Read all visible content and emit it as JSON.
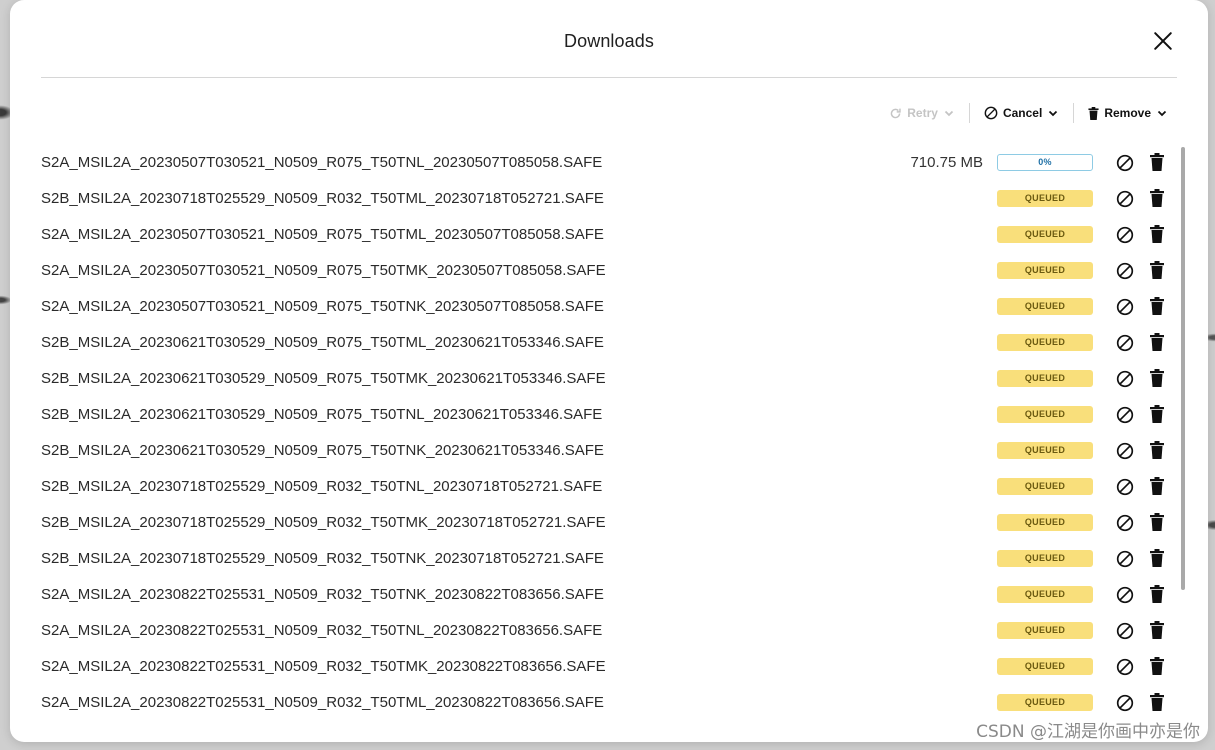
{
  "dialog": {
    "title": "Downloads"
  },
  "toolbar": {
    "retry_label": "Retry",
    "cancel_label": "Cancel",
    "remove_label": "Remove"
  },
  "colors": {
    "queued_badge": "#f9df7b",
    "progress_border": "#8ecbe4"
  },
  "downloads": [
    {
      "name": "S2A_MSIL2A_20230507T030521_N0509_R075_T50TNL_20230507T085058.SAFE",
      "size": "710.75 MB",
      "status": "0%",
      "progress": 0
    },
    {
      "name": "S2B_MSIL2A_20230718T025529_N0509_R032_T50TML_20230718T052721.SAFE",
      "size": "",
      "status": "QUEUED"
    },
    {
      "name": "S2A_MSIL2A_20230507T030521_N0509_R075_T50TML_20230507T085058.SAFE",
      "size": "",
      "status": "QUEUED"
    },
    {
      "name": "S2A_MSIL2A_20230507T030521_N0509_R075_T50TMK_20230507T085058.SAFE",
      "size": "",
      "status": "QUEUED"
    },
    {
      "name": "S2A_MSIL2A_20230507T030521_N0509_R075_T50TNK_20230507T085058.SAFE",
      "size": "",
      "status": "QUEUED"
    },
    {
      "name": "S2B_MSIL2A_20230621T030529_N0509_R075_T50TML_20230621T053346.SAFE",
      "size": "",
      "status": "QUEUED"
    },
    {
      "name": "S2B_MSIL2A_20230621T030529_N0509_R075_T50TMK_20230621T053346.SAFE",
      "size": "",
      "status": "QUEUED"
    },
    {
      "name": "S2B_MSIL2A_20230621T030529_N0509_R075_T50TNL_20230621T053346.SAFE",
      "size": "",
      "status": "QUEUED"
    },
    {
      "name": "S2B_MSIL2A_20230621T030529_N0509_R075_T50TNK_20230621T053346.SAFE",
      "size": "",
      "status": "QUEUED"
    },
    {
      "name": "S2B_MSIL2A_20230718T025529_N0509_R032_T50TNL_20230718T052721.SAFE",
      "size": "",
      "status": "QUEUED"
    },
    {
      "name": "S2B_MSIL2A_20230718T025529_N0509_R032_T50TMK_20230718T052721.SAFE",
      "size": "",
      "status": "QUEUED"
    },
    {
      "name": "S2B_MSIL2A_20230718T025529_N0509_R032_T50TNK_20230718T052721.SAFE",
      "size": "",
      "status": "QUEUED"
    },
    {
      "name": "S2A_MSIL2A_20230822T025531_N0509_R032_T50TNK_20230822T083656.SAFE",
      "size": "",
      "status": "QUEUED"
    },
    {
      "name": "S2A_MSIL2A_20230822T025531_N0509_R032_T50TNL_20230822T083656.SAFE",
      "size": "",
      "status": "QUEUED"
    },
    {
      "name": "S2A_MSIL2A_20230822T025531_N0509_R032_T50TMK_20230822T083656.SAFE",
      "size": "",
      "status": "QUEUED"
    },
    {
      "name": "S2A_MSIL2A_20230822T025531_N0509_R032_T50TML_20230822T083656.SAFE",
      "size": "",
      "status": "QUEUED"
    }
  ],
  "watermark": "CSDN @江湖是你画中亦是你"
}
